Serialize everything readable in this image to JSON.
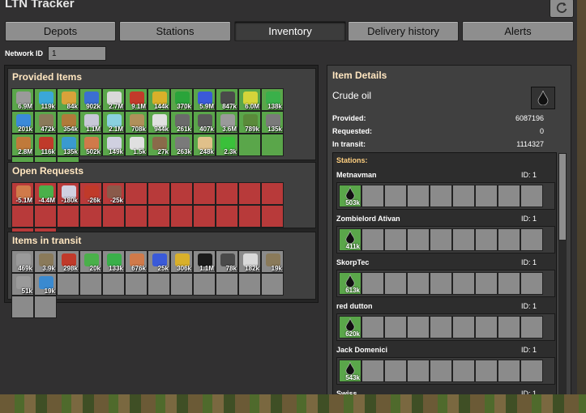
{
  "window": {
    "title": "LTN Tracker"
  },
  "tabs": [
    "Depots",
    "Stations",
    "Inventory",
    "Delivery history",
    "Alerts"
  ],
  "selected_tab": "Inventory",
  "network": {
    "label": "Network ID",
    "value": "1"
  },
  "provided": {
    "title": "Provided Items",
    "items": [
      {
        "icon": "stone-icon",
        "count": "6.9M",
        "color": "#9a9a9a"
      },
      {
        "icon": "copper-cable-icon",
        "count": "119k",
        "color": "#3aa7d8"
      },
      {
        "icon": "coal-icon",
        "count": "84k",
        "color": "#d9a23a"
      },
      {
        "icon": "engine-icon",
        "count": "902k",
        "color": "#3b6fd1"
      },
      {
        "icon": "steel-plate-icon",
        "count": "2.7M",
        "color": "#d9d9d9"
      },
      {
        "icon": "red-circuit-icon",
        "count": "9.1M",
        "color": "#c23a2a"
      },
      {
        "icon": "red-ammo-icon",
        "count": "144k",
        "color": "#d9b02a"
      },
      {
        "icon": "green-arrow-icon",
        "count": "370k",
        "color": "#2aa43a"
      },
      {
        "icon": "blue-circuit-icon",
        "count": "5.9M",
        "color": "#3a5ad9"
      },
      {
        "icon": "iron-ore-icon",
        "count": "847k",
        "color": "#4a4a4a"
      },
      {
        "icon": "sulfur-icon",
        "count": "6.0M",
        "color": "#d4d43a"
      },
      {
        "icon": "green-circuit-icon",
        "count": "138k",
        "color": "#3ab04a"
      },
      {
        "icon": "processing-unit-icon",
        "count": "201k",
        "color": "#3a8ad9"
      },
      {
        "icon": "rail-icon",
        "count": "472k",
        "color": "#8a7a5a"
      },
      {
        "icon": "wood-icon",
        "count": "354k",
        "color": "#b07a3a"
      },
      {
        "icon": "flask-icon",
        "count": "1.1M",
        "color": "#c8c8d8"
      },
      {
        "icon": "flask-blue-icon",
        "count": "2.1M",
        "color": "#8ad0e0"
      },
      {
        "icon": "stone-brick-icon",
        "count": "708k",
        "color": "#b0905a"
      },
      {
        "icon": "science-pack-icon",
        "count": "944k",
        "color": "#e0e0e0"
      },
      {
        "icon": "stone-wall-icon",
        "count": "261k",
        "color": "#6a6a6a"
      },
      {
        "icon": "iron-gear-icon",
        "count": "407k",
        "color": "#5a5a5a"
      },
      {
        "icon": "pipe-icon",
        "count": "3.6M",
        "color": "#9a9a9a"
      },
      {
        "icon": "green-box-icon",
        "count": "789k",
        "color": "#5a8a3a"
      },
      {
        "icon": "iron-plate-icon",
        "count": "135k",
        "color": "#7a7a7a"
      },
      {
        "icon": "copper-ore-icon",
        "count": "2.8M",
        "color": "#c07a3a"
      },
      {
        "icon": "red-box-icon",
        "count": "116k",
        "color": "#c03a2a"
      },
      {
        "icon": "battery-icon",
        "count": "135k",
        "color": "#3a9ad0"
      },
      {
        "icon": "copper-plate-icon",
        "count": "502k",
        "color": "#d07a4a"
      },
      {
        "icon": "light-oil-icon",
        "count": "149k",
        "color": "#d0d0e0"
      },
      {
        "icon": "flask-white-icon",
        "count": "1.5k",
        "color": "#e0e0e0"
      },
      {
        "icon": "solid-fuel-icon",
        "count": "27k",
        "color": "#8a6a4a"
      },
      {
        "icon": "fence-icon",
        "count": "263k",
        "color": "#7a7a7a"
      },
      {
        "icon": "chemical-flask-icon",
        "count": "248k",
        "color": "#e0c08a"
      },
      {
        "icon": "green-tube-icon",
        "count": "2.3k",
        "color": "#3ac03a"
      }
    ]
  },
  "requests": {
    "title": "Open Requests",
    "items": [
      {
        "icon": "copper-plate-icon",
        "count": "-5.1M",
        "color": "#d07a4a"
      },
      {
        "icon": "green-circuit-icon",
        "count": "-4.4M",
        "color": "#4ab04a"
      },
      {
        "icon": "flask-icon",
        "count": "-180k",
        "color": "#d0d0e0"
      },
      {
        "icon": "red-circuit-icon",
        "count": "-26k",
        "color": "#c03a2a"
      },
      {
        "icon": "iron-gear-icon",
        "count": "-25k",
        "color": "#8a5a4a"
      }
    ]
  },
  "transit": {
    "title": "Items in transit",
    "items": [
      {
        "icon": "stone-icon",
        "count": "469k",
        "color": "#9a9a9a"
      },
      {
        "icon": "iron-gear-icon",
        "count": "3.9k",
        "color": "#8a7a5a"
      },
      {
        "icon": "red-circuit-icon",
        "count": "298k",
        "color": "#c03a2a"
      },
      {
        "icon": "green-leaf-icon",
        "count": "20k",
        "color": "#4ab04a"
      },
      {
        "icon": "green-circuit-icon",
        "count": "133k",
        "color": "#3ab04a"
      },
      {
        "icon": "copper-plate-icon",
        "count": "676k",
        "color": "#d07a4a"
      },
      {
        "icon": "blue-circuit-icon",
        "count": "25k",
        "color": "#3a5ad9"
      },
      {
        "icon": "red-ammo-icon",
        "count": "306k",
        "color": "#d9b02a"
      },
      {
        "icon": "crude-oil-icon",
        "count": "1.1M",
        "color": "#1a1a1a"
      },
      {
        "icon": "iron-ore-icon",
        "count": "78k",
        "color": "#4a4a4a"
      },
      {
        "icon": "steel-plate-icon",
        "count": "182k",
        "color": "#d9d9d9"
      },
      {
        "icon": "rail-icon",
        "count": "19k",
        "color": "#8a7a5a"
      },
      {
        "icon": "pipe-icon",
        "count": "51k",
        "color": "#9a9a9a"
      },
      {
        "icon": "engine-icon",
        "count": "19k",
        "color": "#3a8ad0"
      }
    ]
  },
  "details": {
    "title": "Item Details",
    "item_name": "Crude oil",
    "item_icon": "crude-oil-icon",
    "provided_label": "Provided:",
    "provided_value": "6087196",
    "requested_label": "Requested:",
    "requested_value": "0",
    "transit_label": "In transit:",
    "transit_value": "1114327",
    "stations_label": "Stations:",
    "stations": [
      {
        "name": "Metnavman",
        "id": "ID: 1",
        "count": "503k"
      },
      {
        "name": "Zombielord Ativan",
        "id": "ID: 1",
        "count": "411k"
      },
      {
        "name": "SkorpTec",
        "id": "ID: 1",
        "count": "613k"
      },
      {
        "name": "red dutton",
        "id": "ID: 1",
        "count": "620k"
      },
      {
        "name": "Jack Domenici",
        "id": "ID: 1",
        "count": "543k"
      },
      {
        "name": "Swiss",
        "id": "ID: 1",
        "count": ""
      }
    ]
  }
}
